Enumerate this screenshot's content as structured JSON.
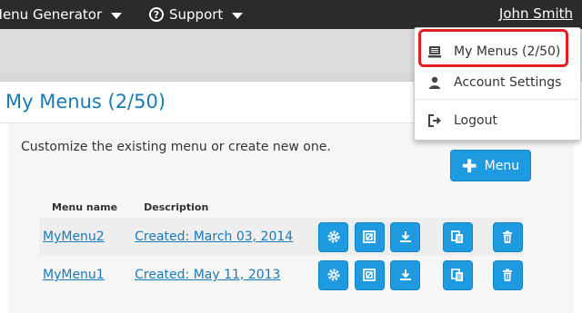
{
  "nav": {
    "menu_generator_label": "Menu Generator",
    "support_label": "Support",
    "user_name": "John Smith"
  },
  "panel": {
    "title": "My Menus (2/50)",
    "intro": "Customize the existing menu or create new one.",
    "add_button_label": "Menu"
  },
  "table": {
    "columns": [
      "Menu name",
      "Description"
    ],
    "rows": [
      {
        "name": "MyMenu2",
        "description": "Created: March 03, 2014"
      },
      {
        "name": "MyMenu1",
        "description": "Created: May 11, 2013"
      }
    ],
    "row_action_icons": [
      "gear-icon",
      "resize-icon",
      "download-icon",
      "copy-icon",
      "trash-icon"
    ]
  },
  "dropdown": {
    "items": [
      {
        "label": "My Menus (2/50)",
        "icon": "menu-list-icon"
      },
      {
        "label": "Account Settings",
        "icon": "user-icon"
      },
      {
        "label": "Logout",
        "icon": "logout-icon"
      }
    ]
  },
  "colors": {
    "accent": "#1e9ae0",
    "title_blue": "#1a7ab7",
    "topbar": "#2b2b2b",
    "highlight_red": "#e02020"
  }
}
